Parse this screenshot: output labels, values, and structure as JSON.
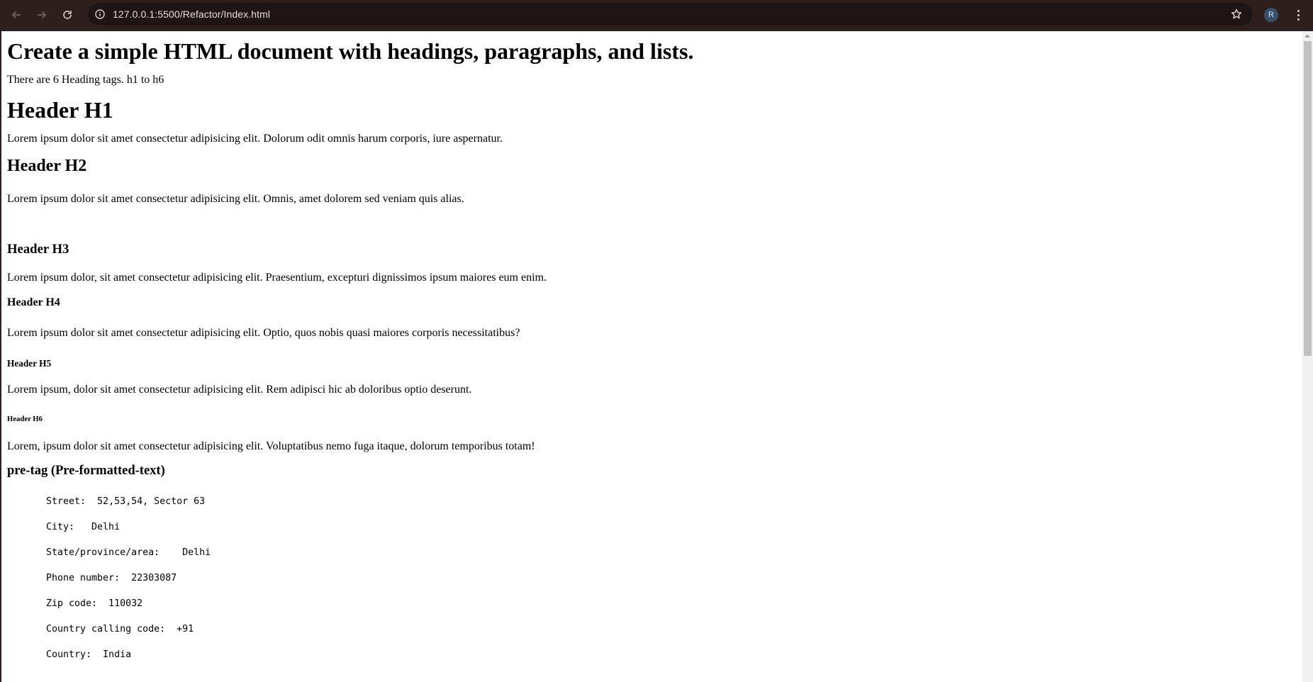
{
  "browser": {
    "url": "127.0.0.1:5500/Refactor/Index.html",
    "profile_initial": "R",
    "icons": {
      "back": "arrow-left-icon",
      "forward": "arrow-right-icon",
      "reload": "reload-icon",
      "site_info": "info-icon",
      "bookmark": "star-icon",
      "menu": "kebab-menu-icon"
    }
  },
  "page": {
    "title": "Create a simple HTML document with headings, paragraphs, and lists.",
    "intro": "There are 6 Heading tags. h1 to h6",
    "sections": [
      {
        "heading": "Header H1",
        "text": "Lorem ipsum dolor sit amet consectetur adipisicing elit. Dolorum odit omnis harum corporis, iure aspernatur."
      },
      {
        "heading": "Header H2",
        "text": "Lorem ipsum dolor sit amet consectetur adipisicing elit. Omnis, amet dolorem sed veniam quis alias."
      },
      {
        "heading": "Header H3",
        "text": "Lorem ipsum dolor, sit amet consectetur adipisicing elit. Praesentium, excepturi dignissimos ipsum maiores eum enim."
      },
      {
        "heading": "Header H4",
        "text": "Lorem ipsum dolor sit amet consectetur adipisicing elit. Optio, quos nobis quasi maiores corporis necessitatibus?"
      },
      {
        "heading": "Header H5",
        "text": "Lorem ipsum, dolor sit amet consectetur adipisicing elit. Rem adipisci hic ab doloribus optio deserunt."
      },
      {
        "heading": "Header H6",
        "text": "Lorem, ipsum dolor sit amet consectetur adipisicing elit. Voluptatibus nemo fuga itaque, dolorum temporibus totam!"
      }
    ],
    "pre_heading": "pre-tag (Pre-formatted-text)",
    "pre_lines": [
      "Street:  52,53,54, Sector 63",
      "City:   Delhi",
      "State/province/area:    Delhi",
      "Phone number:  22303087",
      "Zip code:  110032",
      "Country calling code:  +91",
      "Country:  India"
    ]
  }
}
